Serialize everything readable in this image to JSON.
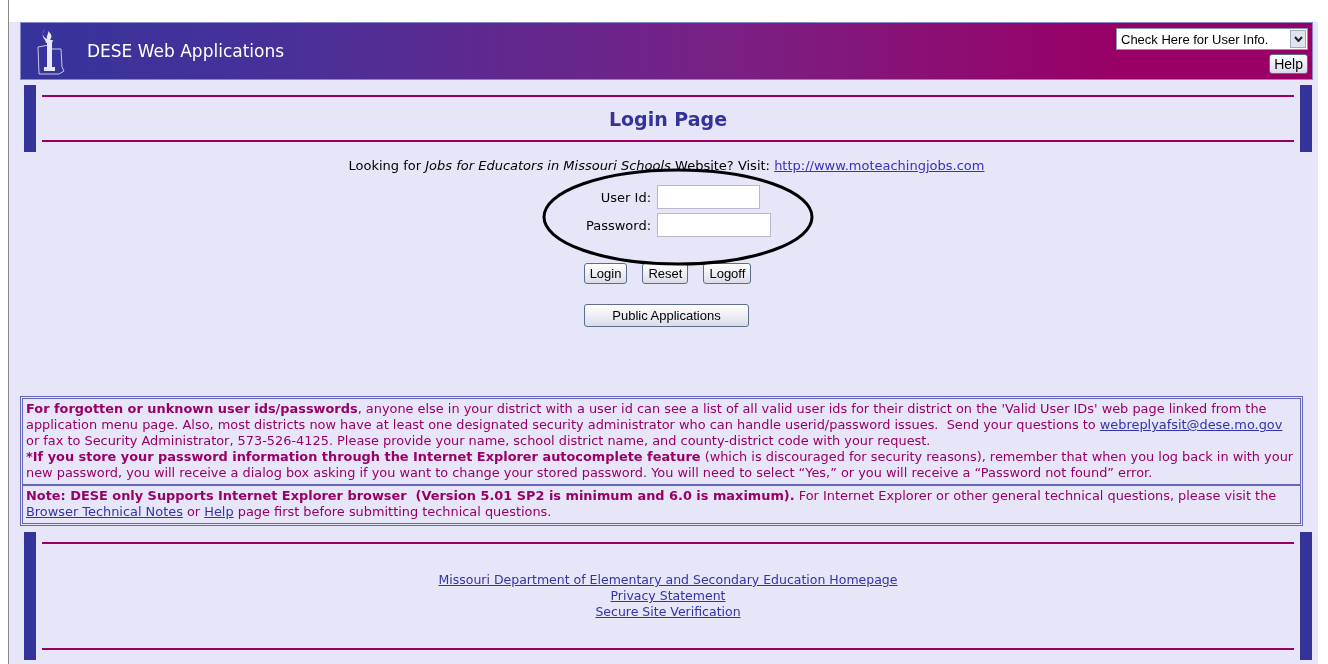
{
  "header": {
    "title": "DESE Web Applications",
    "user_info_select": {
      "value": "Check Here for User Info."
    },
    "help_button": "Help"
  },
  "login_panel": {
    "title": "Login Page"
  },
  "jobs_notice": {
    "text": "Looking for *Jobs for Educators in Missouri Schools* Website? Visit:",
    "link": "http://www.moteachingjobs.com"
  },
  "fields": [
    {
      "label": "User Id:"
    },
    {
      "label": "Password:"
    }
  ],
  "buttons": [
    "Login",
    "Reset",
    "Logoff"
  ],
  "public_button": "Public Applications",
  "notice_box": {
    "sections": [
      {
        "paragraphs": [
          {
            "parts": [
              {
                "kind": "strong",
                "text": "For forgotten or unknown user ids/passwords"
              },
              {
                "kind": "text",
                "text": ", anyone else in your district with a user id can see a list of all valid user ids for their district on the 'Valid User IDs' web page linked from the application menu page. Also, most districts now have at least one designated security administrator who can handle userid/password issues.  Send your questions to "
              },
              {
                "kind": "link",
                "text": "webreplyafsit@dese.mo.gov"
              },
              {
                "kind": "text",
                "text": " or fax to Security Administrator, 573-526-4125. Please provide your name, school district name, and county-district code with your request."
              }
            ]
          },
          {
            "parts": [
              {
                "kind": "strong",
                "text": "*If you store your password information through the Internet Explorer autocomplete feature"
              },
              {
                "kind": "text",
                "text": " (which is discouraged for security reasons), remember that when you log back in with your new password, you will receive a dialog box asking if you want to change your stored password. You will need to select “Yes,” or you will receive a “Password not found” error."
              }
            ]
          }
        ]
      },
      {
        "paragraphs": [
          {
            "parts": [
              {
                "kind": "strong",
                "text": "Note: DESE only Supports Internet Explorer browser  (Version 5.01 SP2 is minimum and 6.0 is maximum)."
              },
              {
                "kind": "text",
                "text": " For Internet Explorer or other general technical questions, please visit the "
              },
              {
                "kind": "link",
                "text": "Browser Technical Notes"
              },
              {
                "kind": "text",
                "text": " or "
              },
              {
                "kind": "link",
                "text": "Help"
              },
              {
                "kind": "text",
                "text": " page first before submitting technical questions."
              }
            ]
          }
        ]
      }
    ]
  },
  "footer": {
    "links": [
      "Missouri Department of Elementary and Secondary Education Homepage",
      "Privacy Statement",
      "Secure Site Verification"
    ]
  }
}
